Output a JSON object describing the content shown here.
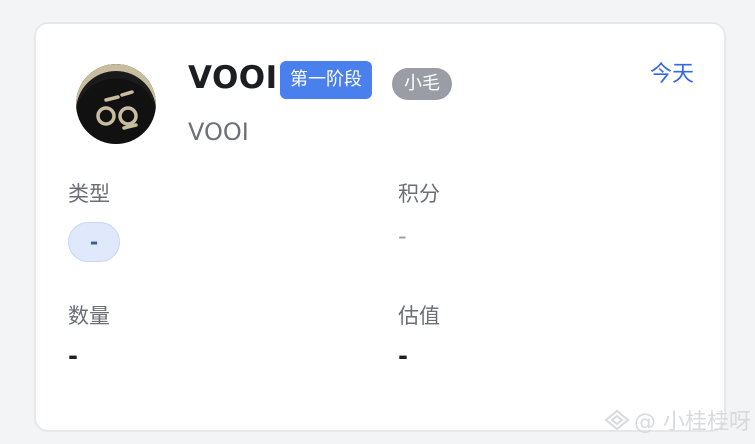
{
  "card": {
    "name": "VOOI",
    "stage_badge": "第一阶段",
    "owner_badge": "小毛",
    "date": "今天",
    "sub_name": "VOOI",
    "fields": {
      "type_label": "类型",
      "type_value": "-",
      "points_label": "积分",
      "points_value": "-",
      "quantity_label": "数量",
      "quantity_value": "-",
      "valuation_label": "估值",
      "valuation_value": "-"
    }
  },
  "watermark": {
    "icon": "weibo-like-icon",
    "text": "@ 小桂桂呀"
  },
  "colors": {
    "stage_badge_bg": "#4a80ee",
    "owner_badge_bg": "#9a9da6",
    "link": "#3668e6"
  }
}
